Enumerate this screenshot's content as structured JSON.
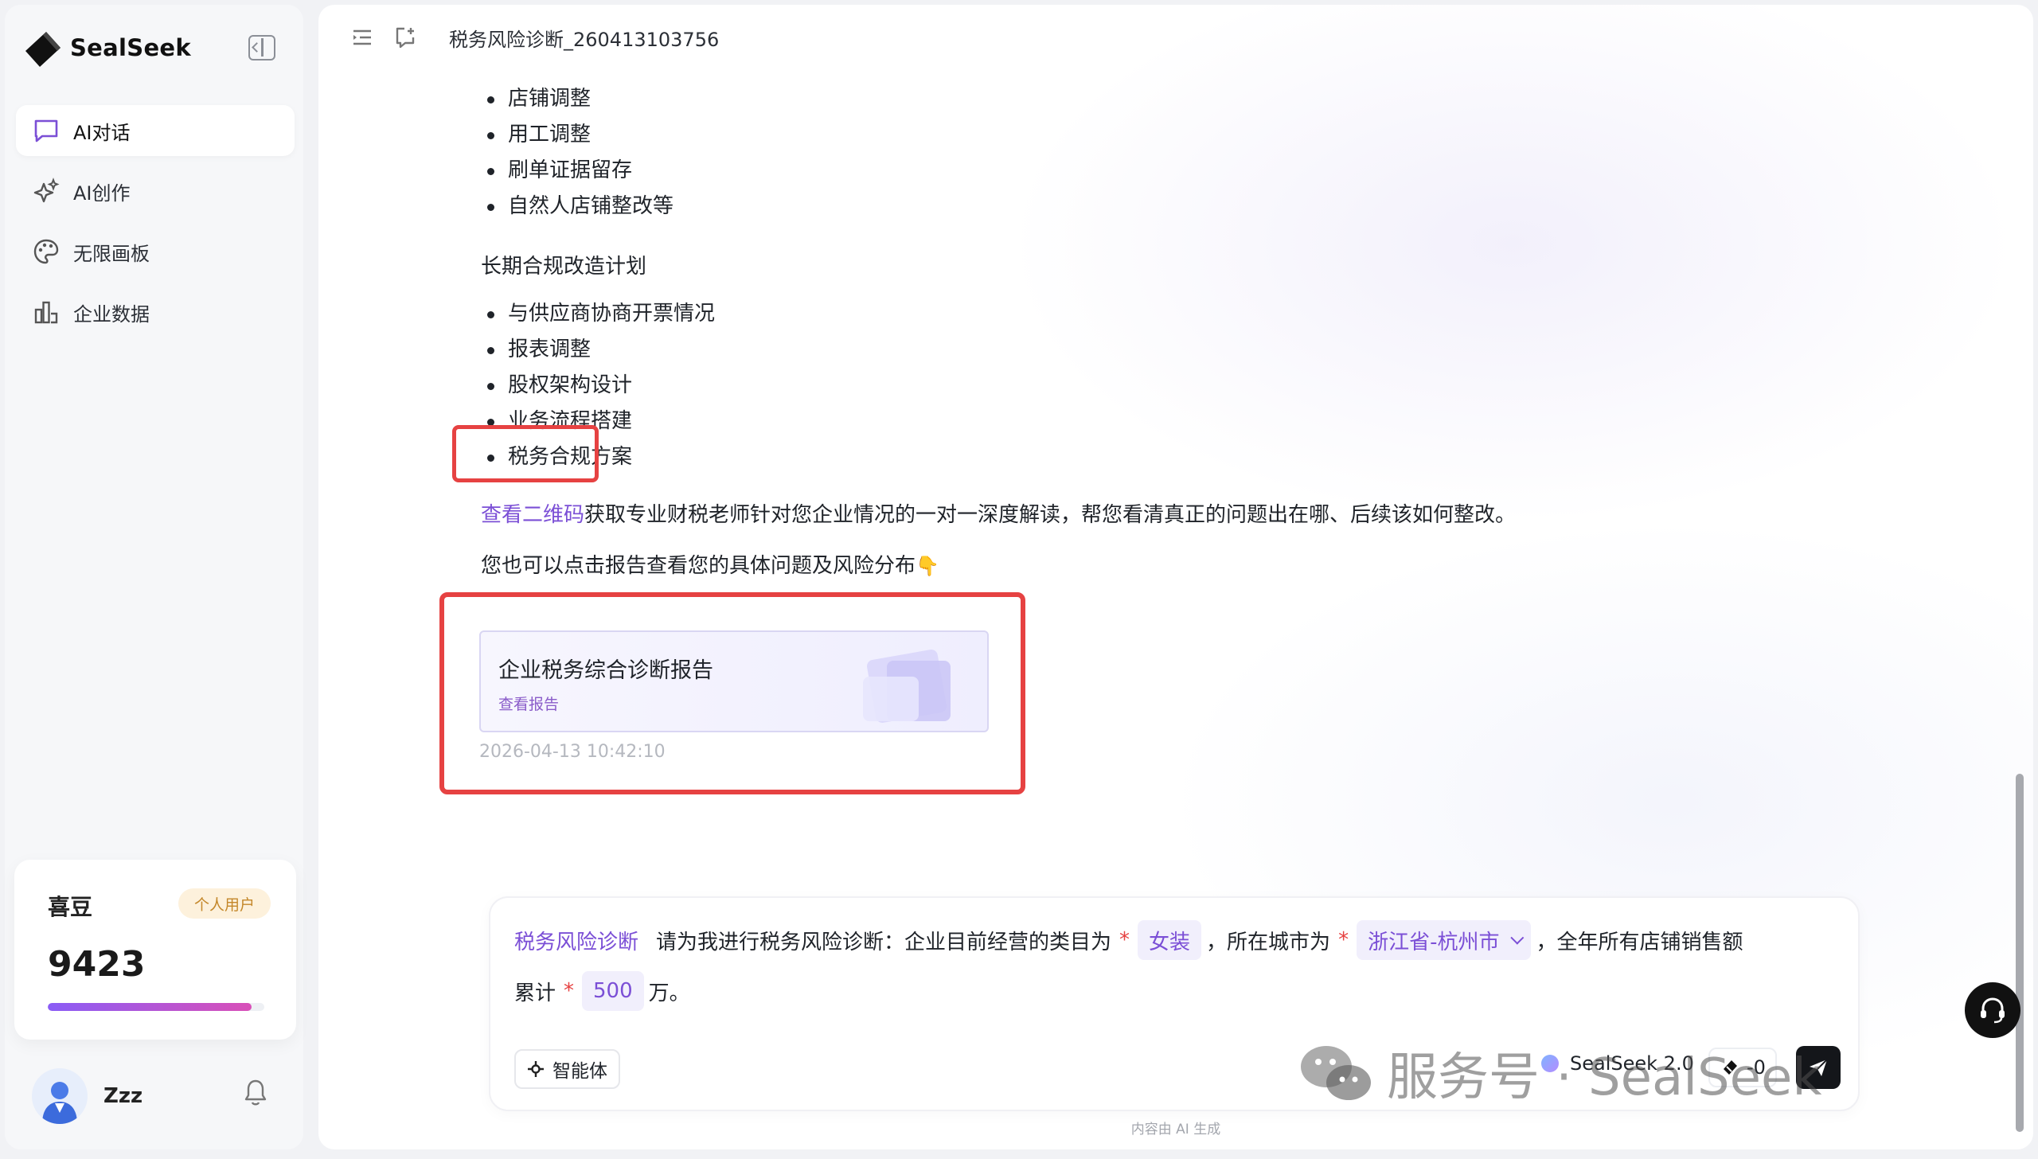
{
  "brand": {
    "name": "SealSeek"
  },
  "sidebar": {
    "items": [
      {
        "label": "AI对话",
        "icon": "chat-icon",
        "active": true
      },
      {
        "label": "AI创作",
        "icon": "sparkle-icon",
        "active": false
      },
      {
        "label": "无限画板",
        "icon": "palette-icon",
        "active": false
      },
      {
        "label": "企业数据",
        "icon": "bar-chart-icon",
        "active": false
      }
    ],
    "credits": {
      "title": "喜豆",
      "badge": "个人用户",
      "value": "9423",
      "progress": 0.94
    },
    "user": {
      "name": "Zzz"
    }
  },
  "header": {
    "title": "税务风险诊断_260413103756"
  },
  "message": {
    "list1": [
      "店铺调整",
      "用工调整",
      "刷单证据留存",
      "自然人店铺整改等"
    ],
    "section2_title": "长期合规改造计划",
    "list2": [
      "与供应商协商开票情况",
      "报表调整",
      "股权架构设计",
      "业务流程搭建",
      "税务合规方案"
    ],
    "qr_link": "查看二维码",
    "qr_text": "获取专业财税老师针对您企业情况的一对一深度解读，帮您看清真正的问题出在哪、后续该如何整改。",
    "report_hint": "您也可以点击报告查看您的具体问题及风险分布",
    "report_card": {
      "title": "企业税务综合诊断报告",
      "link": "查看报告"
    },
    "timestamp": "2026-04-13 10:42:10"
  },
  "composer": {
    "skill": "税务风险诊断",
    "text1": "请为我进行税务风险诊断：企业目前经营的类目为",
    "category": "女装",
    "text2": "，所在城市为",
    "city": "浙江省-杭州市",
    "text3": "，全年所有店铺销售额",
    "text4": "累计",
    "amount": "500",
    "unit": "万。",
    "star": "*",
    "agent_button": "智能体",
    "model": "SealSeek 2.0",
    "cost": "-0"
  },
  "watermark": {
    "text": "服务号 · SealSeek"
  },
  "disclaimer": "内容由 AI 生成",
  "colors": {
    "accent": "#7b4fd6",
    "highlight": "#e64242"
  }
}
